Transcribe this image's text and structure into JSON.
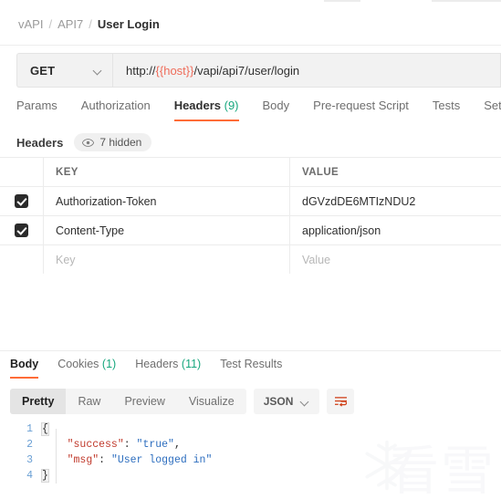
{
  "breadcrumb": {
    "items": [
      "vAPI",
      "API7"
    ],
    "separator": "/",
    "current": "User Login"
  },
  "request": {
    "method": "GET",
    "url_prefix": "http://",
    "url_variable": "{{host}}",
    "url_suffix": "/vapi/api7/user/login",
    "variable_color": "#ef6c5a",
    "tabs": [
      {
        "label": "Params",
        "active": false
      },
      {
        "label": "Authorization",
        "active": false
      },
      {
        "label": "Headers",
        "count": "(9)",
        "active": true
      },
      {
        "label": "Body",
        "active": false
      },
      {
        "label": "Pre-request Script",
        "active": false
      },
      {
        "label": "Tests",
        "active": false
      },
      {
        "label": "Settin",
        "active": false
      }
    ],
    "headers_section": {
      "title": "Headers",
      "hidden_label": "7 hidden",
      "hidden_icon": "eye-icon",
      "columns": [
        "KEY",
        "VALUE"
      ],
      "rows": [
        {
          "checked": true,
          "key": "Authorization-Token",
          "value": "dGVzdDE6MTIzNDU2"
        },
        {
          "checked": true,
          "key": "Content-Type",
          "value": "application/json"
        }
      ],
      "placeholder_row": {
        "key": "Key",
        "value": "Value"
      }
    }
  },
  "response": {
    "tabs": [
      {
        "label": "Body",
        "active": true
      },
      {
        "label": "Cookies",
        "count": "(1)",
        "active": false
      },
      {
        "label": "Headers",
        "count": "(11)",
        "active": false
      },
      {
        "label": "Test Results",
        "active": false
      }
    ],
    "format_tabs": [
      {
        "label": "Pretty",
        "active": true
      },
      {
        "label": "Raw",
        "active": false
      },
      {
        "label": "Preview",
        "active": false
      },
      {
        "label": "Visualize",
        "active": false
      }
    ],
    "language": "JSON",
    "wrap_icon": "wrap-lines-icon",
    "body_lines": [
      {
        "num": "1",
        "code": "{"
      },
      {
        "num": "2",
        "code": "    \"success\": \"true\","
      },
      {
        "num": "3",
        "code": "    \"msg\": \"User logged in\""
      },
      {
        "num": "4",
        "code": "}"
      }
    ],
    "body_tokens": [
      {
        "num": "1",
        "parts": [
          {
            "t": "{",
            "c": "brace"
          }
        ]
      },
      {
        "num": "2",
        "parts": [
          {
            "t": "    ",
            "c": "plain"
          },
          {
            "t": "\"success\"",
            "c": "key"
          },
          {
            "t": ": ",
            "c": "plain"
          },
          {
            "t": "\"true\"",
            "c": "str"
          },
          {
            "t": ",",
            "c": "plain"
          }
        ]
      },
      {
        "num": "3",
        "parts": [
          {
            "t": "    ",
            "c": "plain"
          },
          {
            "t": "\"msg\"",
            "c": "key"
          },
          {
            "t": ": ",
            "c": "plain"
          },
          {
            "t": "\"User logged in\"",
            "c": "str"
          }
        ]
      },
      {
        "num": "4",
        "parts": [
          {
            "t": "}",
            "c": "brace"
          }
        ]
      }
    ]
  },
  "watermark": {
    "text": "看雪",
    "icon": "snowflake-icon"
  },
  "colors": {
    "accent": "#ff6c37",
    "count_green": "#17a77e",
    "json_key": "#c0392b",
    "json_string": "#2d6ebf",
    "line_number": "#6a9fd4"
  }
}
